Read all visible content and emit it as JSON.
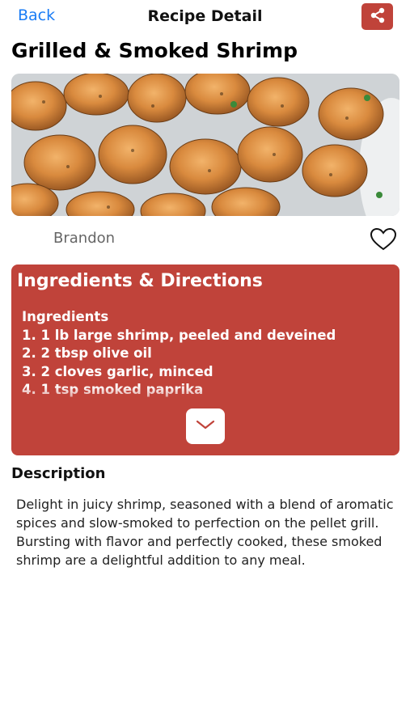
{
  "nav": {
    "back_label": "Back",
    "title": "Recipe Detail",
    "share_icon": "share-icon"
  },
  "recipe": {
    "title": "Grilled & Smoked Shrimp",
    "image": "grilled-shrimp-photo",
    "author": "Brandon",
    "favorite_icon": "heart-outline-icon"
  },
  "ingredients_card": {
    "heading": "Ingredients & Directions",
    "subheading": "Ingredients",
    "items": [
      "1. 1 lb large shrimp, peeled and deveined",
      "2. 2 tbsp olive oil",
      "3. 2 cloves garlic, minced",
      "4. 1 tsp smoked paprika"
    ],
    "expand_icon": "chevron-down-icon"
  },
  "description": {
    "heading": "Description",
    "text": "Delight in juicy shrimp, seasoned with a blend of aromatic spices and slow-smoked to perfection on the pellet grill. Bursting with flavor and perfectly cooked, these smoked shrimp are a delightful addition to any meal."
  },
  "colors": {
    "accent": "#c0433a",
    "link": "#1a7cf5"
  }
}
